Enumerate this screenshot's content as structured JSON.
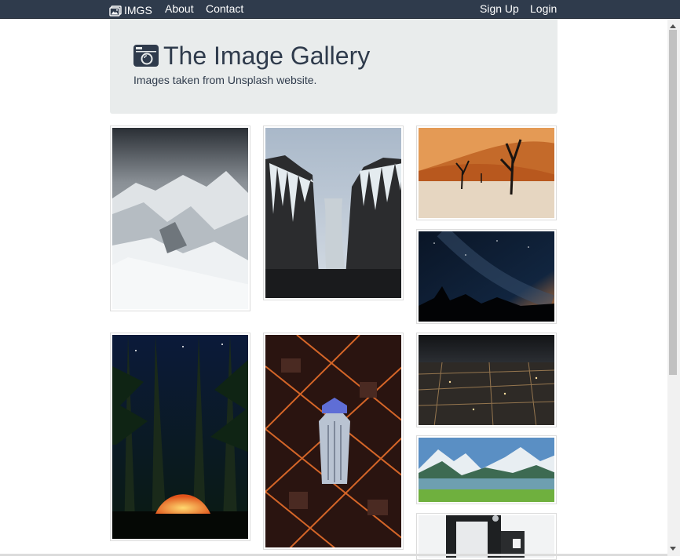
{
  "nav": {
    "brand": "IMGS",
    "about": "About",
    "contact": "Contact",
    "signup": "Sign Up",
    "login": "Login"
  },
  "header": {
    "title": "The Image Gallery",
    "subtitle": "Images taken from Unsplash website."
  },
  "gallery": [
    {
      "name": "snowy-mountains"
    },
    {
      "name": "frozen-waterfall"
    },
    {
      "name": "desert-dead-trees"
    },
    {
      "name": "milky-way-night"
    },
    {
      "name": "forest-tent-night"
    },
    {
      "name": "city-skyscraper-aerial"
    },
    {
      "name": "city-lights-night"
    },
    {
      "name": "alpine-lake"
    },
    {
      "name": "interior-room"
    }
  ]
}
